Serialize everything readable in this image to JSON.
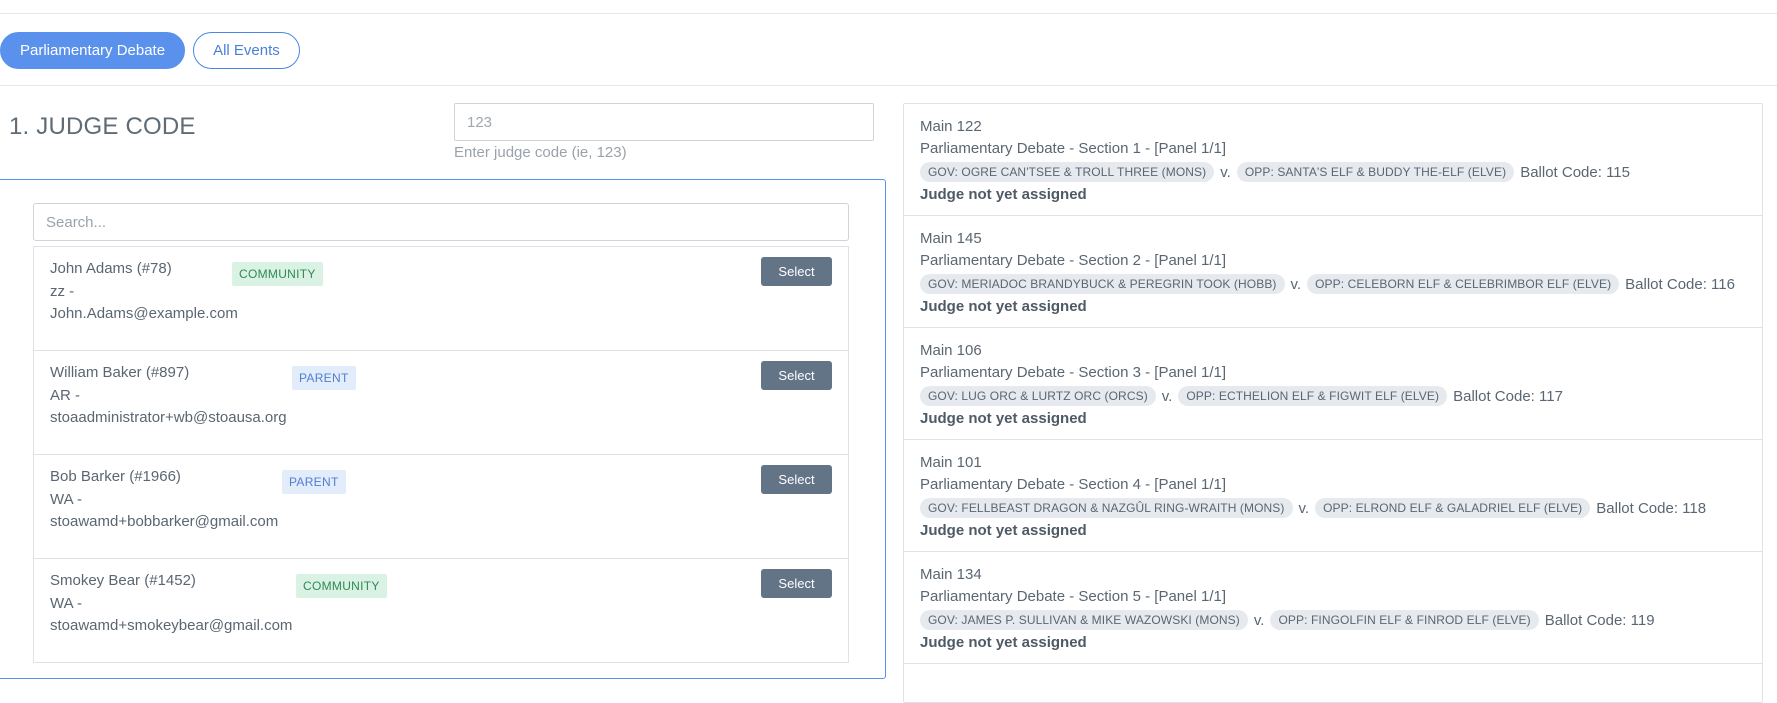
{
  "tabs": [
    {
      "label": "Parliamentary Debate",
      "active": true
    },
    {
      "label": "All Events",
      "active": false
    }
  ],
  "judge_code": {
    "title": "1. JUDGE CODE",
    "placeholder": "123",
    "help": "Enter judge code (ie, 123)"
  },
  "judges": {
    "search_placeholder": "Search...",
    "select_label": "Select",
    "items": [
      {
        "name": "John Adams (#78)",
        "school": "zz -",
        "email": "John.Adams@example.com",
        "badge": "COMMUNITY"
      },
      {
        "name": "William Baker (#897)",
        "school": "AR -",
        "email": "stoaadministrator+wb@stoausa.org",
        "badge": "PARENT"
      },
      {
        "name": "Bob Barker (#1966)",
        "school": "WA -",
        "email": "stoawamd+bobbarker@gmail.com",
        "badge": "PARENT"
      },
      {
        "name": "Smokey Bear (#1452)",
        "school": "WA -",
        "email": "stoawamd+smokeybear@gmail.com",
        "badge": "COMMUNITY"
      }
    ]
  },
  "rounds": {
    "vs_label": "v.",
    "items": [
      {
        "room": "Main 122",
        "section": "Parliamentary Debate - Section 1 - [Panel 1/1]",
        "gov": "GOV: OGRE CAN'TSEE & TROLL THREE (MONS)",
        "opp": "OPP: SANTA'S ELF & BUDDY THE-ELF (ELVE)",
        "ballot": "Ballot Code: 115",
        "status": "Judge not yet assigned"
      },
      {
        "room": "Main 145",
        "section": "Parliamentary Debate - Section 2 - [Panel 1/1]",
        "gov": "GOV: MERIADOC BRANDYBUCK & PEREGRIN TOOK (HOBB)",
        "opp": "OPP: CELEBORN ELF & CELEBRIMBOR ELF (ELVE)",
        "ballot": "Ballot Code: 116",
        "status": "Judge not yet assigned"
      },
      {
        "room": "Main 106",
        "section": "Parliamentary Debate - Section 3 - [Panel 1/1]",
        "gov": "GOV: LUG ORC & LURTZ ORC (ORCS)",
        "opp": "OPP: ECTHELION ELF & FIGWIT ELF (ELVE)",
        "ballot": "Ballot Code: 117",
        "status": "Judge not yet assigned"
      },
      {
        "room": "Main 101",
        "section": "Parliamentary Debate - Section 4 - [Panel 1/1]",
        "gov": "GOV: FELLBEAST DRAGON & NAZGÛL RING-WRAITH (MONS)",
        "opp": "OPP: ELROND ELF & GALADRIEL ELF (ELVE)",
        "ballot": "Ballot Code: 118",
        "status": "Judge not yet assigned"
      },
      {
        "room": "Main 134",
        "section": "Parliamentary Debate - Section 5 - [Panel 1/1]",
        "gov": "GOV: JAMES P. SULLIVAN & MIKE WAZOWSKI (MONS)",
        "opp": "OPP: FINGOLFIN ELF & FINROD ELF (ELVE)",
        "ballot": "Ballot Code: 119",
        "status": "Judge not yet assigned"
      }
    ]
  }
}
